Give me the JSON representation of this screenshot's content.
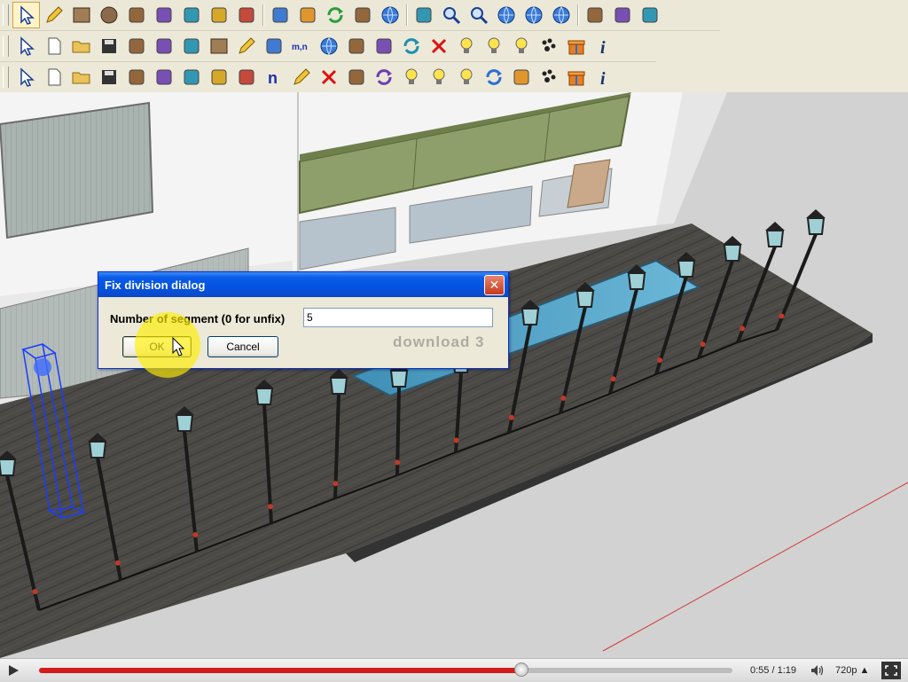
{
  "toolbars": {
    "row1": [
      "select-arrow-icon",
      "pencil-icon",
      "rectangle-icon",
      "circle-icon",
      "arc-icon",
      "paint-bucket-icon",
      "eraser-icon",
      "tape-measure-icon",
      "paint-brush-icon",
      "push-pull-icon",
      "rotate-star-icon",
      "follow-me-icon",
      "offset-icon",
      "orbit-icon",
      "pan-hand-icon",
      "zoom-icon",
      "zoom-extents-icon",
      "globe-icon",
      "3d-warehouse-icon",
      "geo-location-icon",
      "components-icon",
      "share-model-icon",
      "house-icon"
    ],
    "row2": [
      "select-arrow-icon",
      "new-file-icon",
      "open-folder-icon",
      "save-disk-icon",
      "grid-icon",
      "stamp-icon",
      "link-icon",
      "box-icon",
      "pencil-icon",
      "divide-icon",
      "mn-text-icon",
      "globe-icon",
      "hammer-icon",
      "node-icon",
      "refresh-icon",
      "delete-x-icon",
      "bulb-off-icon",
      "bulbs-group-icon",
      "bulb-on-icon",
      "paw-prints-icon",
      "gift-icon",
      "info-icon"
    ],
    "row3": [
      "select-arrow-icon",
      "new-file-icon",
      "open-folder-icon",
      "save-disk-icon",
      "nodes-icon",
      "stamp-icon",
      "link-icon",
      "gear-icon",
      "curve-icon",
      "n-letter-icon",
      "pencil-icon",
      "delete-x-icon",
      "pipette-icon",
      "refresh-icon",
      "bulb-off-icon",
      "bulbs-group-icon",
      "bulb-on-icon",
      "arrows-icon",
      "branch-icon",
      "paw-prints-icon",
      "gift-icon",
      "info-icon"
    ]
  },
  "dialog": {
    "title": "Fix division dialog",
    "close_label": "✕",
    "label": "Number of segment (0 for unfix)",
    "input_value": "5",
    "ok_label": "OK",
    "cancel_label": "Cancel"
  },
  "watermark": "download 3",
  "player": {
    "time": "0:55 / 1:19",
    "quality": "720p ▲",
    "progress_fraction": 0.696
  },
  "colors": {
    "toolbar_bg": "#ece9d8",
    "title_blue": "#0a5de8",
    "progress_red": "#d21c1c",
    "highlight_yellow": "#ffee00"
  }
}
